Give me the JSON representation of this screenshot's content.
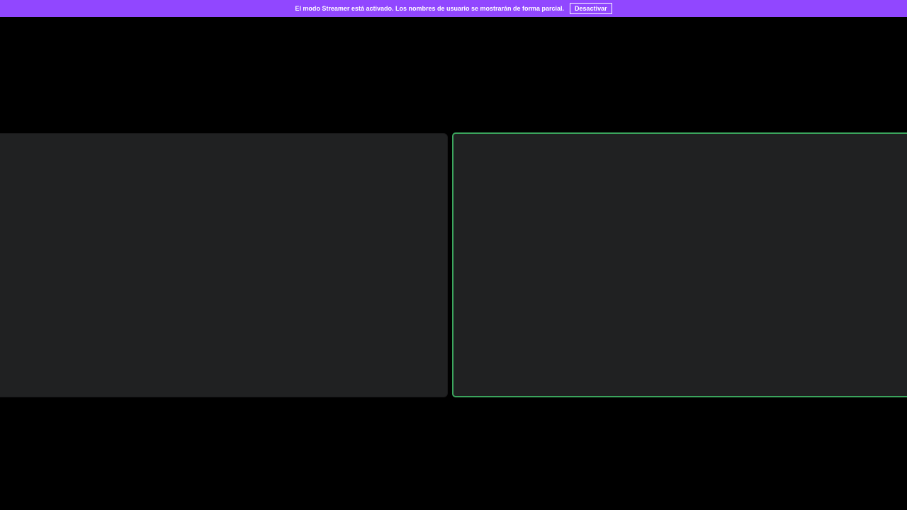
{
  "banner": {
    "message": "El modo Streamer está activado. Los nombres de usuario se mostrarán de forma parcial.",
    "button_label": "Desactivar",
    "background_color": "#9147ff"
  },
  "video_grid": {
    "tiles": [
      {
        "state": "idle"
      },
      {
        "state": "speaking",
        "highlight_color": "#3ba55d"
      }
    ],
    "tile_color": "#202122",
    "background_color": "#000000"
  }
}
